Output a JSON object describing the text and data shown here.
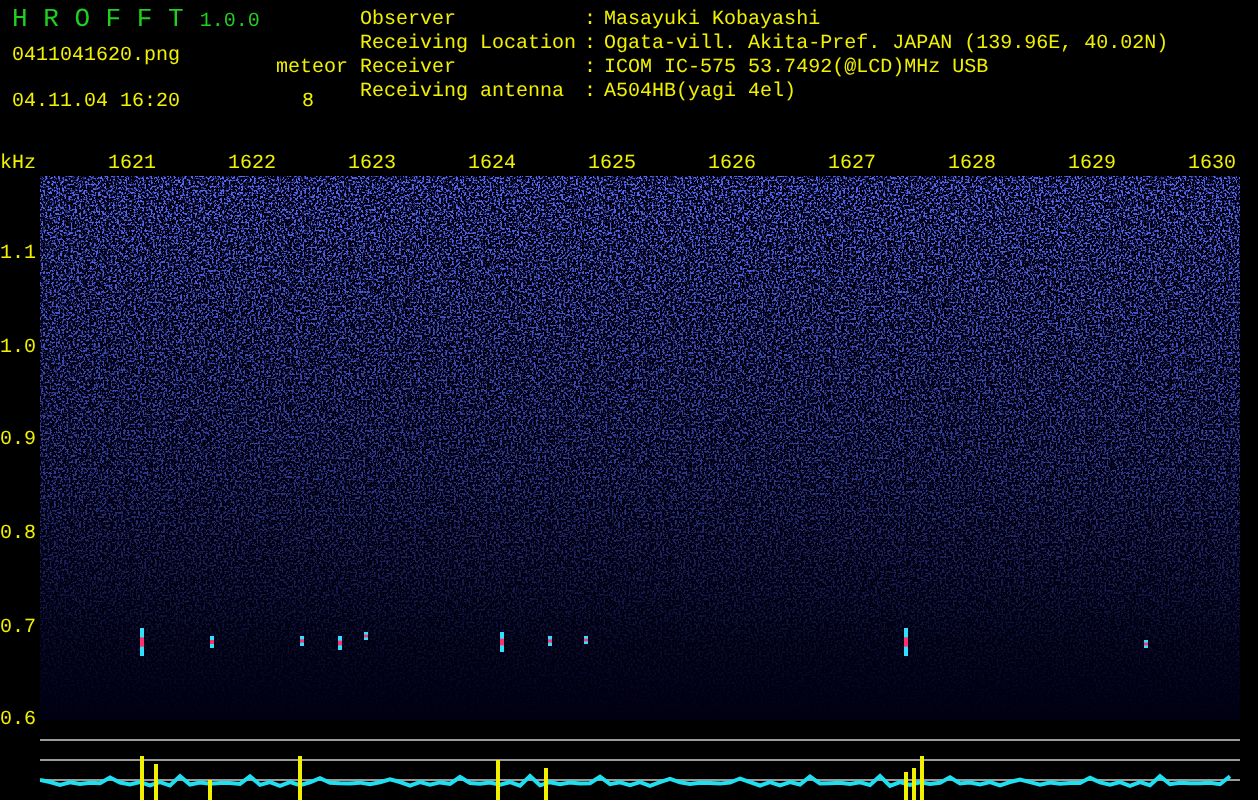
{
  "app": {
    "title": "H R O F F T",
    "version": "1.0.0"
  },
  "file": {
    "name": "0411041620.png",
    "datetime": "04.11.04 16:20"
  },
  "meteor": {
    "label": "meteor",
    "count": "8"
  },
  "info": [
    {
      "label": "Observer",
      "separator": ":",
      "value": "Masayuki Kobayashi"
    },
    {
      "label": "Receiving Location",
      "separator": ":",
      "value": "Ogata-vill. Akita-Pref. JAPAN (139.96E, 40.02N)"
    },
    {
      "label": "Receiver",
      "separator": ":",
      "value": "ICOM IC-575 53.7492(@LCD)MHz USB"
    },
    {
      "label": "Receiving antenna",
      "separator": ":",
      "value": "A504HB(yagi 4el)"
    }
  ],
  "spectrogram": {
    "unit": "kHz",
    "time_labels": [
      "1621",
      "1622",
      "1623",
      "1624",
      "1625",
      "1626",
      "1627",
      "1628",
      "1629",
      "1630"
    ],
    "freq_labels": [
      "1.1",
      "1.0",
      "0.9",
      "0.8",
      "0.7",
      "0.6"
    ]
  }
}
